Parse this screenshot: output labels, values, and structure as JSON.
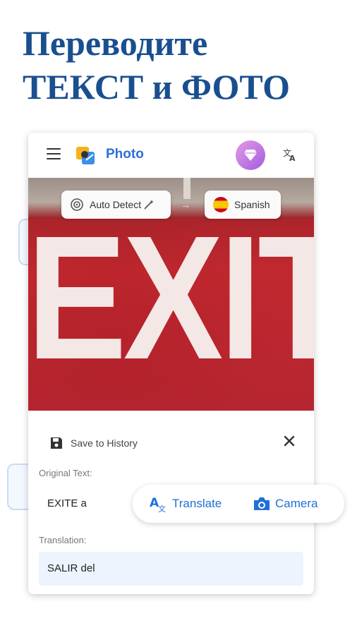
{
  "headline": {
    "line1": "Переводите",
    "line2": "ТЕКСТ и ФОТО"
  },
  "appbar": {
    "title": "Photo"
  },
  "photo": {
    "sign_text": "EXIT"
  },
  "languages": {
    "source": "Auto Detect",
    "target": "Spanish",
    "arrow": "→"
  },
  "sheet": {
    "save_label": "Save to History",
    "original_label": "Original Text:",
    "original_text": "EXITE a",
    "translation_label": "Translation:",
    "translation_text": "SALIR del"
  },
  "actions": {
    "translate": "Translate",
    "camera": "Camera"
  },
  "colors": {
    "brand_blue": "#1a4f8f",
    "accent_blue": "#1f6fd9",
    "sign_red": "#c1282f"
  }
}
